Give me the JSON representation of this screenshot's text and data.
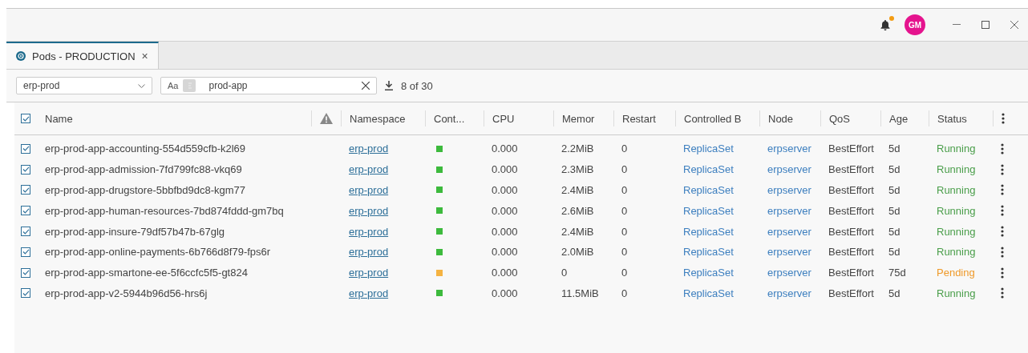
{
  "titlebar": {
    "avatar": "GM",
    "notification_unread": true
  },
  "tabs": [
    {
      "label": "Pods - PRODUCTION",
      "selected": true,
      "close": "×"
    }
  ],
  "toolbar": {
    "namespace": "erp-prod",
    "case_toggle": "Aa",
    "search_value": "prod-app",
    "count": "8 of 30"
  },
  "table": {
    "select_all": true,
    "columns": [
      "Name",
      "",
      "Namespace",
      "Cont...",
      "CPU",
      "Memor",
      "Restart",
      "Controlled B",
      "Node",
      "QoS",
      "Age",
      "Status"
    ],
    "rows": [
      {
        "checked": true,
        "name": "erp-prod-app-accounting-554d559cfb-k2l69",
        "namespace": "erp-prod",
        "color": "#3dba3d",
        "cpu": "0.000",
        "memory": "2.2MiB",
        "restarts": "0",
        "controlled_by": "ReplicaSet",
        "node": "erpserver",
        "qos": "BestEffort",
        "age": "5d",
        "status": "Running",
        "kind": "running"
      },
      {
        "checked": true,
        "name": "erp-prod-app-admission-7fd799fc88-vkq69",
        "namespace": "erp-prod",
        "color": "#3dba3d",
        "cpu": "0.000",
        "memory": "2.3MiB",
        "restarts": "0",
        "controlled_by": "ReplicaSet",
        "node": "erpserver",
        "qos": "BestEffort",
        "age": "5d",
        "status": "Running",
        "kind": "running"
      },
      {
        "checked": true,
        "name": "erp-prod-app-drugstore-5bbfbd9dc8-kgm77",
        "namespace": "erp-prod",
        "color": "#3dba3d",
        "cpu": "0.000",
        "memory": "2.4MiB",
        "restarts": "0",
        "controlled_by": "ReplicaSet",
        "node": "erpserver",
        "qos": "BestEffort",
        "age": "5d",
        "status": "Running",
        "kind": "running"
      },
      {
        "checked": true,
        "name": "erp-prod-app-human-resources-7bd874fddd-gm7bq",
        "namespace": "erp-prod",
        "color": "#3dba3d",
        "cpu": "0.000",
        "memory": "2.6MiB",
        "restarts": "0",
        "controlled_by": "ReplicaSet",
        "node": "erpserver",
        "qos": "BestEffort",
        "age": "5d",
        "status": "Running",
        "kind": "running"
      },
      {
        "checked": true,
        "name": "erp-prod-app-insure-79df57b47b-67glg",
        "namespace": "erp-prod",
        "color": "#3dba3d",
        "cpu": "0.000",
        "memory": "2.4MiB",
        "restarts": "0",
        "controlled_by": "ReplicaSet",
        "node": "erpserver",
        "qos": "BestEffort",
        "age": "5d",
        "status": "Running",
        "kind": "running"
      },
      {
        "checked": true,
        "name": "erp-prod-app-online-payments-6b766d8f79-fps6r",
        "namespace": "erp-prod",
        "color": "#3dba3d",
        "cpu": "0.000",
        "memory": "2.0MiB",
        "restarts": "0",
        "controlled_by": "ReplicaSet",
        "node": "erpserver",
        "qos": "BestEffort",
        "age": "5d",
        "status": "Running",
        "kind": "running"
      },
      {
        "checked": true,
        "name": "erp-prod-app-smartone-ee-5f6ccfc5f5-gt824",
        "namespace": "erp-prod",
        "color": "#f5b342",
        "cpu": "0.000",
        "memory": "0",
        "restarts": "0",
        "controlled_by": "ReplicaSet",
        "node": "erpserver",
        "qos": "BestEffort",
        "age": "75d",
        "status": "Pending",
        "kind": "pending"
      },
      {
        "checked": true,
        "name": "erp-prod-app-v2-5944b96d56-hrs6j",
        "namespace": "erp-prod",
        "color": "#3dba3d",
        "cpu": "0.000",
        "memory": "11.5MiB",
        "restarts": "0",
        "controlled_by": "ReplicaSet",
        "node": "erpserver",
        "qos": "BestEffort",
        "age": "5d",
        "status": "Running",
        "kind": "running"
      }
    ]
  }
}
